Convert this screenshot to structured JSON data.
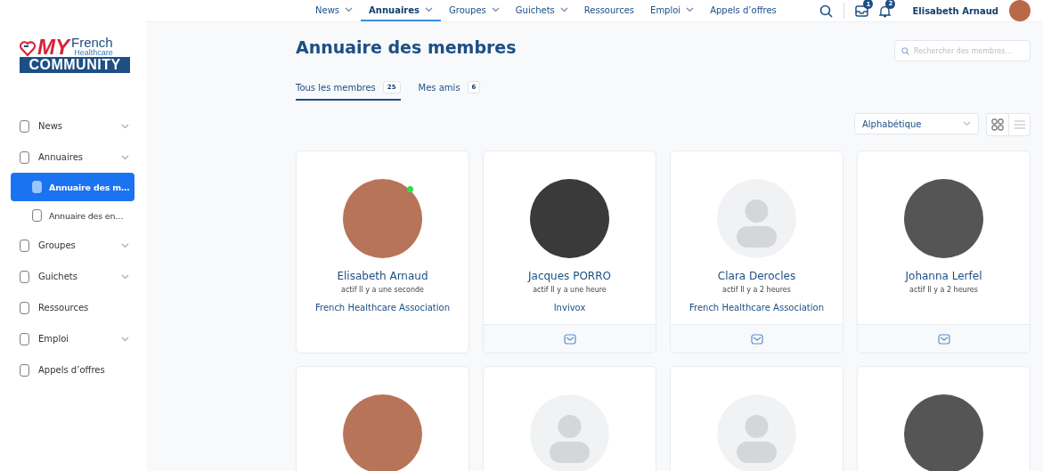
{
  "logo": {
    "my": "MY",
    "french": "French",
    "healthcare": "Healthcare",
    "community": "COMMUNITY"
  },
  "sidebar": {
    "items": [
      {
        "label": "News",
        "expandable": true,
        "selected": false
      },
      {
        "label": "Annuaires",
        "expandable": true,
        "selected": false,
        "children": [
          {
            "label": "Annuaire des m…",
            "selected": true
          },
          {
            "label": "Annuaire des en…",
            "selected": false
          }
        ]
      },
      {
        "label": "Groupes",
        "expandable": true,
        "selected": false
      },
      {
        "label": "Guichets",
        "expandable": true,
        "selected": false
      },
      {
        "label": "Ressources",
        "expandable": false,
        "selected": false
      },
      {
        "label": "Emploi",
        "expandable": true,
        "selected": false
      },
      {
        "label": "Appels d’offres",
        "expandable": false,
        "selected": false
      }
    ]
  },
  "top_nav": {
    "items": [
      {
        "label": "News",
        "dropdown": true,
        "selected": false
      },
      {
        "label": "Annuaires",
        "dropdown": true,
        "selected": true
      },
      {
        "label": "Groupes",
        "dropdown": true,
        "selected": false
      },
      {
        "label": "Guichets",
        "dropdown": true,
        "selected": false
      },
      {
        "label": "Ressources",
        "dropdown": false,
        "selected": false
      },
      {
        "label": "Emploi",
        "dropdown": true,
        "selected": false
      },
      {
        "label": "Appels d’offres",
        "dropdown": false,
        "selected": false
      }
    ],
    "messages_badge": "1",
    "notifications_badge": "2",
    "user_name": "Elisabeth Arnaud"
  },
  "page": {
    "title": "Annuaire des membres",
    "search": {
      "placeholder": "Rechercher des membres…"
    },
    "tabs": [
      {
        "label": "Tous les membres",
        "count": "25",
        "selected": true
      },
      {
        "label": "Mes amis",
        "count": "6",
        "selected": false
      }
    ],
    "sort": {
      "value": "Alphabétique"
    },
    "view_toggle": [
      {
        "kind": "grid",
        "selected": true
      },
      {
        "kind": "list",
        "selected": false
      }
    ]
  },
  "members": [
    {
      "name": "Elisabeth Arnaud",
      "activity": "actif Il y a une seconde",
      "organization": "French Healthcare Association",
      "kind": "photo",
      "online": true,
      "message_button": false
    },
    {
      "name": "Jacques PORRO",
      "activity": "actif Il y a une heure",
      "organization": "Invivox",
      "kind": "photo",
      "online": false,
      "message_button": true
    },
    {
      "name": "Clara Derocles",
      "activity": "actif Il y a 2 heures",
      "organization": "French Healthcare Association",
      "kind": "placeholder",
      "online": false,
      "message_button": true
    },
    {
      "name": "Johanna Lerfel",
      "activity": "actif Il y a 2 heures",
      "kind": "photo",
      "online": false,
      "message_button": true
    },
    {
      "kind": "photo",
      "online": false
    },
    {
      "kind": "placeholder",
      "online": false
    },
    {
      "kind": "placeholder",
      "online": false
    },
    {
      "kind": "photo",
      "online": false
    }
  ]
}
